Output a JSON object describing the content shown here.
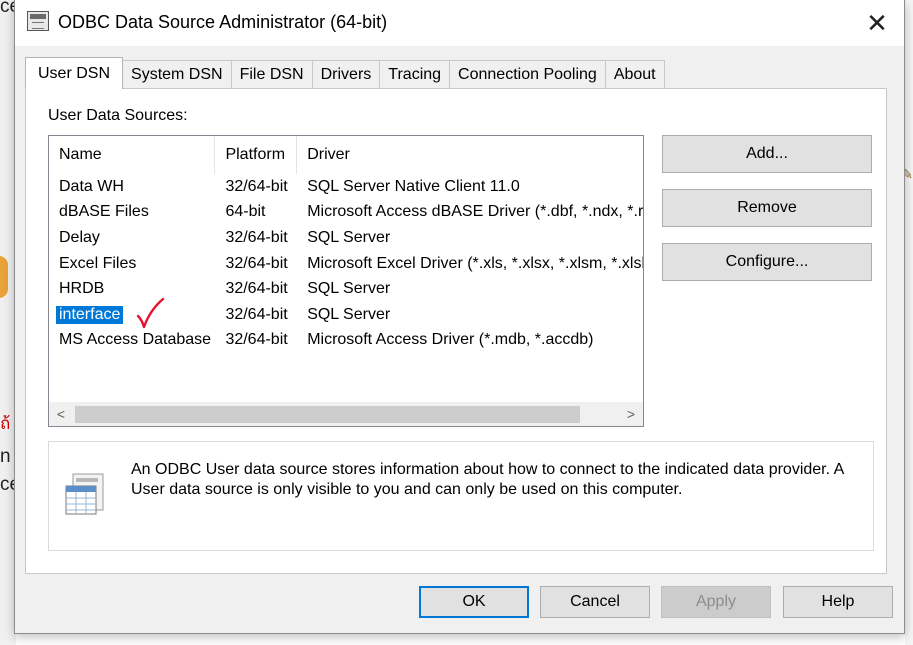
{
  "background": {
    "fragments": [
      "ce",
      "n",
      "ce"
    ],
    "red_fragment": "ถ้"
  },
  "window": {
    "title": "ODBC Data Source Administrator (64-bit)",
    "close_label": "✕"
  },
  "tabs": [
    {
      "label": "User DSN",
      "active": true
    },
    {
      "label": "System DSN"
    },
    {
      "label": "File DSN"
    },
    {
      "label": "Drivers"
    },
    {
      "label": "Tracing"
    },
    {
      "label": "Connection Pooling"
    },
    {
      "label": "About"
    }
  ],
  "user_dsn": {
    "section_label": "User Data Sources:",
    "columns": {
      "name": "Name",
      "platform": "Platform",
      "driver": "Driver"
    },
    "rows": [
      {
        "name": "Data WH",
        "platform": "32/64-bit",
        "driver": "SQL Server Native Client 11.0"
      },
      {
        "name": "dBASE Files",
        "platform": "64-bit",
        "driver": "Microsoft Access dBASE Driver (*.dbf, *.ndx, *.r"
      },
      {
        "name": "Delay",
        "platform": "32/64-bit",
        "driver": "SQL Server"
      },
      {
        "name": "Excel Files",
        "platform": "32/64-bit",
        "driver": "Microsoft Excel Driver (*.xls, *.xlsx, *.xlsm, *.xlsb"
      },
      {
        "name": "HRDB",
        "platform": "32/64-bit",
        "driver": "SQL Server"
      },
      {
        "name": "interface",
        "platform": "32/64-bit",
        "driver": "SQL Server",
        "selected": true
      },
      {
        "name": "MS Access Database",
        "platform": "32/64-bit",
        "driver": "Microsoft Access Driver (*.mdb, *.accdb)"
      }
    ],
    "scroll_left": "<",
    "scroll_right": ">",
    "buttons": {
      "add": "Add...",
      "remove": "Remove",
      "configure": "Configure..."
    },
    "info_text": "An ODBC User data source stores information about how to connect to the indicated data provider.   A User data source is only visible to you and can only be used on this computer."
  },
  "footer": {
    "ok": "OK",
    "cancel": "Cancel",
    "apply": "Apply",
    "help": "Help"
  },
  "colors": {
    "selection": "#0078d7",
    "checkmark": "#e8102e"
  },
  "icons": {
    "title": "odbc-window-icon",
    "info": "data-table-icon",
    "annotation": "red-checkmark-icon"
  }
}
